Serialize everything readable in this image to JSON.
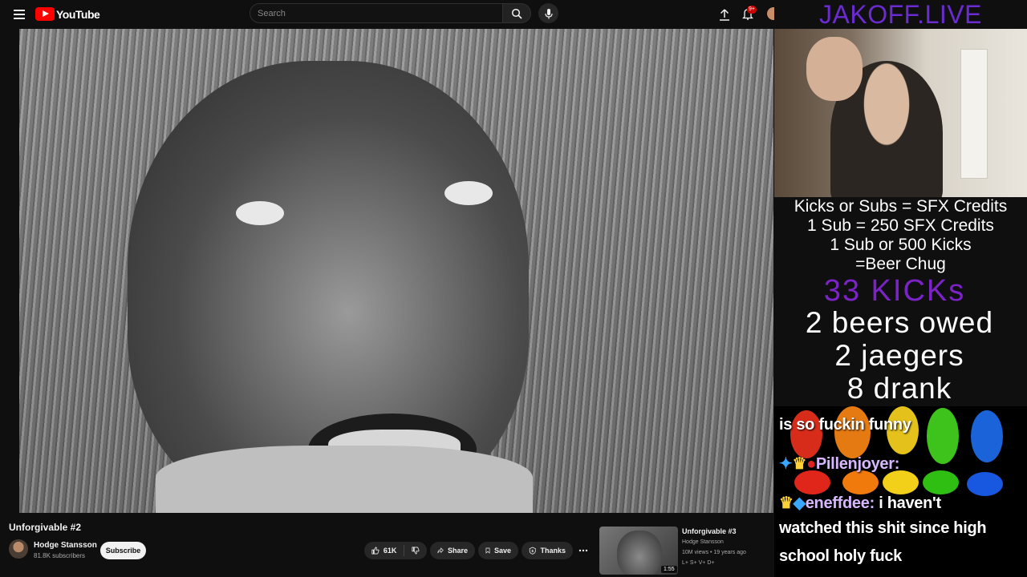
{
  "youtube": {
    "logo_text": "YouTube",
    "search_placeholder": "Search",
    "notification_count": "9+",
    "icons": [
      "menu-icon",
      "search-icon",
      "mic-icon",
      "upload-icon",
      "bell-icon"
    ]
  },
  "video": {
    "title": "Unforgivable #2",
    "channel": "Hodge Stansson",
    "subscribers": "81.8K subscribers",
    "subscribe_label": "Subscribe",
    "likes": "61K",
    "share_label": "Share",
    "save_label": "Save",
    "thanks_label": "Thanks"
  },
  "recommended": {
    "title": "Unforgivable #3",
    "channel": "Hodge Stansson",
    "meta": "10M views • 19 years ago",
    "tags": "L+ S+ V+ D+",
    "duration": "1:55"
  },
  "overlay": {
    "site": "JAKOFF.LIVE",
    "info_lines": [
      "Kicks or Subs = SFX Credits",
      "1 Sub = 250 SFX Credits",
      "1 Sub or 500 Kicks",
      "=Beer Chug"
    ],
    "kicks": "33 KICKs",
    "counters": [
      "2 beers owed",
      "2 jaegers",
      "8 drank"
    ]
  },
  "chat": {
    "line1": "is so fuckin funny",
    "user1": "Pillenjoyer:",
    "user2": "eneffdee:",
    "msg2": " i haven't",
    "line3": "watched this shit since high",
    "line4": "school holy fuck"
  },
  "colors": {
    "youtube_red": "#ff0000",
    "overlay_purple": "#6a2bd1",
    "background": "#0f0f0f"
  }
}
